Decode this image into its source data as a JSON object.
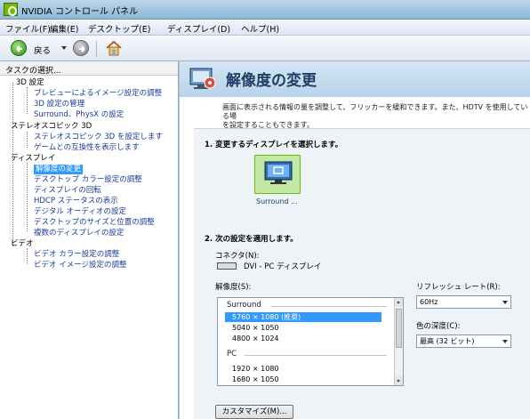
{
  "window": {
    "title": "NVIDIA コントロール パネル"
  },
  "menu": [
    "ファイル(F)",
    "編集(E)",
    "デスクトップ(E)",
    "ディスプレイ(D)",
    "ヘルプ(H)"
  ],
  "toolbar": {
    "back_label": "戻る"
  },
  "tasks": {
    "header": "タスクの選択...",
    "groups": [
      {
        "label": "3D 設定",
        "items": [
          "プレビューによるイメージ設定の調整",
          "3D 設定の管理",
          "Surround、PhysX の設定"
        ]
      },
      {
        "label": "ステレオスコピック 3D",
        "items": [
          "ステレオスコピック 3D を設定します",
          "ゲームとの互換性を表示します"
        ]
      },
      {
        "label": "ディスプレイ",
        "items": [
          "解像度の変更",
          "デスクトップ カラー設定の調整",
          "ディスプレイの回転",
          "HDCP ステータスの表示",
          "デジタル オーディオの設定",
          "デスクトップのサイズと位置の調整",
          "複数のディスプレイの設定"
        ]
      },
      {
        "label": "ビデオ",
        "items": [
          "ビデオ カラー設定の調整",
          "ビデオ イメージ設定の調整"
        ]
      }
    ],
    "selected": "解像度の変更"
  },
  "page": {
    "title": "解像度の変更",
    "description_line1": "画面に表示される情報の量を調整して、フリッカーを緩和できます。また、HDTV を使用している場",
    "description_line2": "を設定することもできます。",
    "section1_title": "1. 変更するディスプレイを選択します。",
    "display_label": "Surround ...",
    "section2_title": "2. 次の設定を適用します。",
    "connector_label": "コネクタ(N):",
    "connector_value": "DVI - PC ディスプレイ",
    "resolution_label": "解像度(S):",
    "resolution_groups": [
      {
        "label": "Surround",
        "items": [
          "5760 × 1080 (推奨)",
          "5040 × 1050",
          "4800 × 1024"
        ]
      },
      {
        "label": "PC",
        "items": [
          "1920 × 1080",
          "1680 × 1050"
        ]
      }
    ],
    "selected_resolution": "5760 × 1080 (推奨)",
    "refresh_label": "リフレッシュ レート(R):",
    "refresh_value": "60Hz",
    "color_depth_label": "色の深度(C):",
    "color_depth_value": "最高 (32 ビット)",
    "customize_label": "カスタマイズ(M)..."
  },
  "colors": {
    "nvidia_green": "#76b900",
    "selection_blue": "#3399ff",
    "header_blue": "#b9d3ea"
  }
}
